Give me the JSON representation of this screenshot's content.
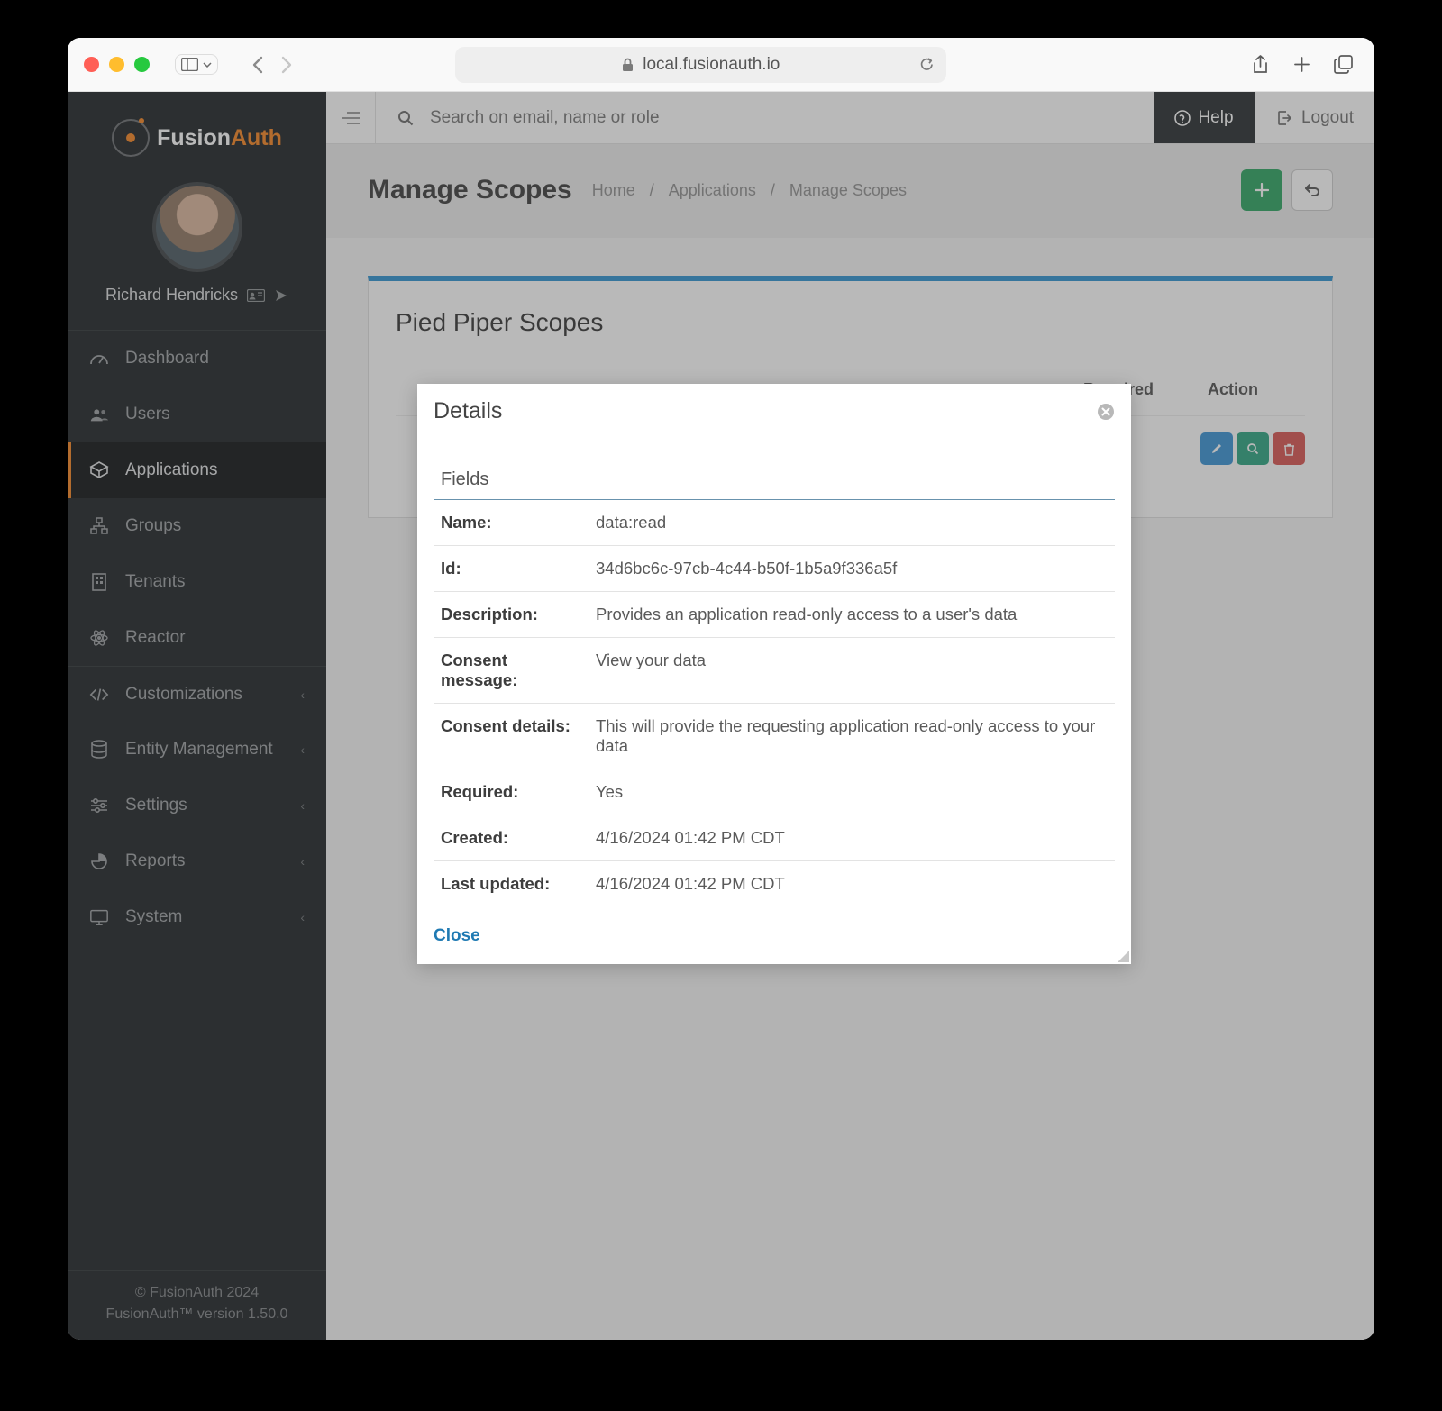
{
  "browser": {
    "url": "local.fusionauth.io"
  },
  "brand": {
    "part1": "Fusion",
    "part2": "Auth"
  },
  "user": {
    "name": "Richard Hendricks"
  },
  "nav": {
    "dashboard": "Dashboard",
    "users": "Users",
    "applications": "Applications",
    "groups": "Groups",
    "tenants": "Tenants",
    "reactor": "Reactor",
    "customizations": "Customizations",
    "entity_management": "Entity Management",
    "settings": "Settings",
    "reports": "Reports",
    "system": "System"
  },
  "footer": {
    "line1": "© FusionAuth 2024",
    "line2": "FusionAuth™ version 1.50.0"
  },
  "topbar": {
    "search_placeholder": "Search on email, name or role",
    "help": "Help",
    "logout": "Logout"
  },
  "page": {
    "title": "Manage Scopes",
    "breadcrumbs": {
      "home": "Home",
      "sep": "/",
      "applications": "Applications",
      "current": "Manage Scopes"
    }
  },
  "panel": {
    "title": "Pied Piper Scopes",
    "columns": {
      "required": "Required",
      "action": "Action"
    }
  },
  "modal": {
    "title": "Details",
    "fields_heading": "Fields",
    "labels": {
      "name": "Name:",
      "id": "Id:",
      "description": "Description:",
      "consent_message": "Consent message:",
      "consent_details": "Consent details:",
      "required": "Required:",
      "created": "Created:",
      "last_updated": "Last updated:"
    },
    "values": {
      "name": "data:read",
      "id": "34d6bc6c-97cb-4c44-b50f-1b5a9f336a5f",
      "description": "Provides an application read-only access to a user's data",
      "consent_message": "View your data",
      "consent_details": "This will provide the requesting application read-only access to your data",
      "required": "Yes",
      "created": "4/16/2024 01:42 PM CDT",
      "last_updated": "4/16/2024 01:42 PM CDT"
    },
    "close": "Close"
  }
}
